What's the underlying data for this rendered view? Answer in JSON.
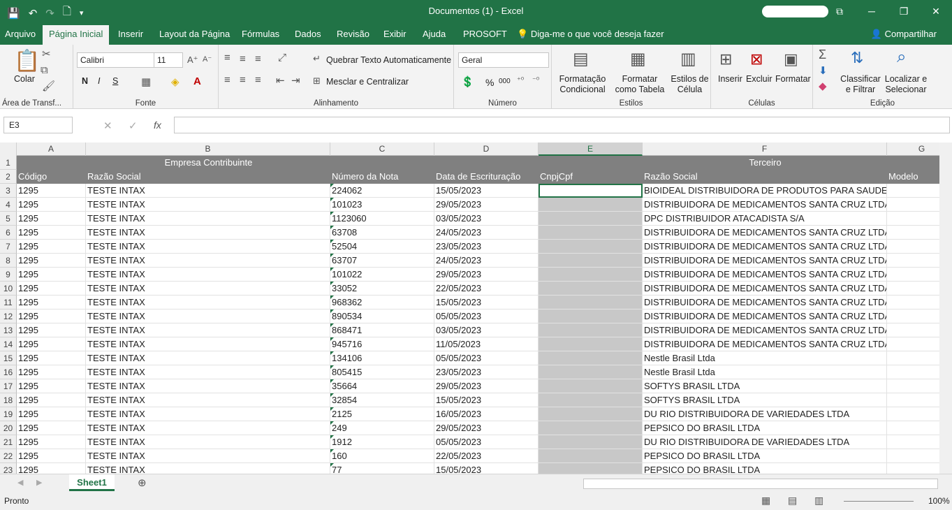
{
  "window": {
    "title": "Documentos (1)  -  Excel",
    "minimize": "─",
    "restore": "❐",
    "close": "✕",
    "box": "⧉"
  },
  "qat": {
    "save": "💾",
    "undo": "↶",
    "redo": "↷",
    "new": "🗋",
    "more": "▾"
  },
  "tabs": [
    "Arquivo",
    "Página Inicial",
    "Inserir",
    "Layout da Página",
    "Fórmulas",
    "Dados",
    "Revisão",
    "Exibir",
    "Ajuda",
    "PROSOFT",
    "Diga-me o que você deseja fazer"
  ],
  "share": "Compartilhar",
  "ribbon": {
    "clipboard": {
      "paste": "Colar",
      "label": "Área de Transf..."
    },
    "font": {
      "name": "Calibri",
      "size": "11",
      "bold": "N",
      "italic": "I",
      "underline": "S",
      "label": "Fonte"
    },
    "align": {
      "wrap": "Quebrar Texto Automaticamente",
      "merge": "Mesclar e Centralizar",
      "label": "Alinhamento"
    },
    "number": {
      "format": "Geral",
      "percent": "%",
      "thousands": "000",
      "label": "Número"
    },
    "styles": {
      "cond": "Formatação Condicional",
      "table": "Formatar como Tabela",
      "cell": "Estilos de Célula",
      "label": "Estilos"
    },
    "cells": {
      "insert": "Inserir",
      "delete": "Excluir",
      "format": "Formatar",
      "label": "Células"
    },
    "editing": {
      "sort": "Classificar e Filtrar",
      "find": "Localizar e Selecionar",
      "label": "Edição"
    }
  },
  "namebox": "E3",
  "fx": "fx",
  "columns": [
    "A",
    "B",
    "C",
    "D",
    "E",
    "F",
    "G"
  ],
  "header1": {
    "b": "Empresa Contribuinte",
    "f": "Terceiro"
  },
  "header2": [
    "Código",
    "Razão Social",
    "Número da Nota",
    "Data de Escrituração",
    "CnpjCpf",
    "Razão Social",
    "Modelo"
  ],
  "rows": [
    [
      "1295",
      "TESTE INTAX",
      "224062",
      "15/05/2023",
      "",
      "BIOIDEAL DISTRIBUIDORA DE PRODUTOS PARA SAUDE LTD"
    ],
    [
      "1295",
      "TESTE INTAX",
      "101023",
      "29/05/2023",
      "",
      "DISTRIBUIDORA DE MEDICAMENTOS SANTA CRUZ LTDA"
    ],
    [
      "1295",
      "TESTE INTAX",
      "1123060",
      "03/05/2023",
      "",
      "DPC DISTRIBUIDOR ATACADISTA S/A"
    ],
    [
      "1295",
      "TESTE INTAX",
      "63708",
      "24/05/2023",
      "",
      "DISTRIBUIDORA DE MEDICAMENTOS SANTA CRUZ LTDA"
    ],
    [
      "1295",
      "TESTE INTAX",
      "52504",
      "23/05/2023",
      "",
      "DISTRIBUIDORA DE MEDICAMENTOS SANTA CRUZ LTDA"
    ],
    [
      "1295",
      "TESTE INTAX",
      "63707",
      "24/05/2023",
      "",
      "DISTRIBUIDORA DE MEDICAMENTOS SANTA CRUZ LTDA"
    ],
    [
      "1295",
      "TESTE INTAX",
      "101022",
      "29/05/2023",
      "",
      "DISTRIBUIDORA DE MEDICAMENTOS SANTA CRUZ LTDA"
    ],
    [
      "1295",
      "TESTE INTAX",
      "33052",
      "22/05/2023",
      "",
      "DISTRIBUIDORA DE MEDICAMENTOS SANTA CRUZ LTDA"
    ],
    [
      "1295",
      "TESTE INTAX",
      "968362",
      "15/05/2023",
      "",
      "DISTRIBUIDORA DE MEDICAMENTOS SANTA CRUZ LTDA"
    ],
    [
      "1295",
      "TESTE INTAX",
      "890534",
      "05/05/2023",
      "",
      "DISTRIBUIDORA DE MEDICAMENTOS SANTA CRUZ LTDA"
    ],
    [
      "1295",
      "TESTE INTAX",
      "868471",
      "03/05/2023",
      "",
      "DISTRIBUIDORA DE MEDICAMENTOS SANTA CRUZ LTDA"
    ],
    [
      "1295",
      "TESTE INTAX",
      "945716",
      "11/05/2023",
      "",
      "DISTRIBUIDORA DE MEDICAMENTOS SANTA CRUZ LTDA"
    ],
    [
      "1295",
      "TESTE INTAX",
      "134106",
      "05/05/2023",
      "",
      "Nestle Brasil Ltda"
    ],
    [
      "1295",
      "TESTE INTAX",
      "805415",
      "23/05/2023",
      "",
      "Nestle Brasil Ltda"
    ],
    [
      "1295",
      "TESTE INTAX",
      "35664",
      "29/05/2023",
      "",
      "SOFTYS BRASIL LTDA"
    ],
    [
      "1295",
      "TESTE INTAX",
      "32854",
      "15/05/2023",
      "",
      "SOFTYS BRASIL LTDA"
    ],
    [
      "1295",
      "TESTE INTAX",
      "2125",
      "16/05/2023",
      "",
      "DU RIO DISTRIBUIDORA DE VARIEDADES LTDA"
    ],
    [
      "1295",
      "TESTE INTAX",
      "249",
      "29/05/2023",
      "",
      "PEPSICO DO BRASIL LTDA"
    ],
    [
      "1295",
      "TESTE INTAX",
      "1912",
      "05/05/2023",
      "",
      "DU RIO DISTRIBUIDORA DE VARIEDADES LTDA"
    ],
    [
      "1295",
      "TESTE INTAX",
      "160",
      "22/05/2023",
      "",
      "PEPSICO DO BRASIL LTDA"
    ],
    [
      "1295",
      "TESTE INTAX",
      "77",
      "15/05/2023",
      "",
      "PEPSICO DO BRASIL LTDA"
    ]
  ],
  "sheet": "Sheet1",
  "status": "Pronto",
  "zoom": "100%"
}
